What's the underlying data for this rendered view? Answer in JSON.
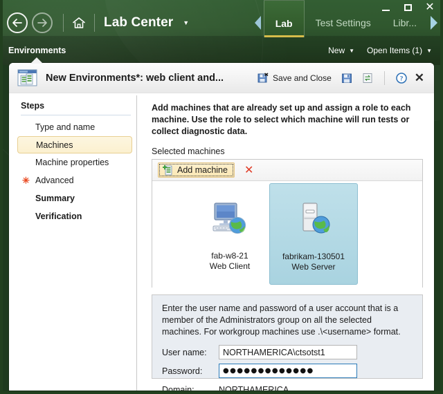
{
  "window": {
    "minimize_label": "Minimize",
    "maximize_label": "Maximize",
    "close_label": "Close"
  },
  "topnav": {
    "back_icon": "back-arrow-icon",
    "forward_icon": "forward-arrow-icon",
    "home_icon": "home-icon",
    "app_title": "Lab Center",
    "title_dropdown": "▼"
  },
  "tabs": {
    "scroll_left": "◀",
    "scroll_right": "▶",
    "items": [
      {
        "label": "Lab",
        "active": true
      },
      {
        "label": "Test Settings",
        "active": false
      },
      {
        "label": "Libr...",
        "active": false
      }
    ]
  },
  "subnav": {
    "section": "Environments",
    "new_label": "New",
    "open_items_label": "Open Items (1)",
    "caret": "▼"
  },
  "dialog": {
    "icon": "environments-window-icon",
    "title": "New Environments*: web client and...",
    "tools": [
      {
        "name": "save-and-close",
        "label": "Save and Close",
        "icon": "save-and-close-icon"
      },
      {
        "name": "save",
        "label": "",
        "icon": "save-icon"
      },
      {
        "name": "refresh",
        "label": "",
        "icon": "refresh-icon"
      }
    ],
    "help_label": "?",
    "close_label": "✕"
  },
  "steps": {
    "title": "Steps",
    "items": [
      {
        "label": "Type and name",
        "current": false,
        "required": false,
        "bold": false
      },
      {
        "label": "Machines",
        "current": true,
        "required": false,
        "bold": false
      },
      {
        "label": "Machine properties",
        "current": false,
        "required": false,
        "bold": false
      },
      {
        "label": "Advanced",
        "current": false,
        "required": true,
        "bold": false
      },
      {
        "label": "Summary",
        "current": false,
        "required": false,
        "bold": true
      },
      {
        "label": "Verification",
        "current": false,
        "required": false,
        "bold": true
      }
    ],
    "required_glyph": "✳"
  },
  "content": {
    "intro": "Add machines that are already set up and assign a role to each machine. Use the role to select which machine will run tests or collect diagnostic data.",
    "selected_machines_label": "Selected machines",
    "toolbar": {
      "add_machine_label": "Add machine",
      "add_machine_icon": "add-machine-icon",
      "delete_icon": "delete-x-icon",
      "delete_label": "✕"
    },
    "machines": [
      {
        "name": "fab-w8-21",
        "role": "Web Client",
        "icon": "computer-web-client-icon",
        "selected": false
      },
      {
        "name": "fabrikam-130501",
        "role": "Web Server",
        "icon": "server-web-server-icon",
        "selected": true
      }
    ]
  },
  "credentials": {
    "description": "Enter the user name and password of a user account that is a member of the Administrators group on all the selected machines. For workgroup machines use .\\<username> format.",
    "username_label": "User name:",
    "username_value": "NORTHAMERICA\\ctsotst1",
    "password_label": "Password:",
    "password_value": "●●●●●●●●●●●●●",
    "domain_label": "Domain:",
    "domain_value": "NORTHAMERICA"
  },
  "colors": {
    "chrome_green": "#2b5329",
    "accent_yellow": "#d6bc4a",
    "selected_tile": "#a9d3e0",
    "required_star": "#ea4a21",
    "delete_red": "#e03b26",
    "current_step": "#fbf0cf",
    "focus_blue": "#2a7ab8"
  }
}
